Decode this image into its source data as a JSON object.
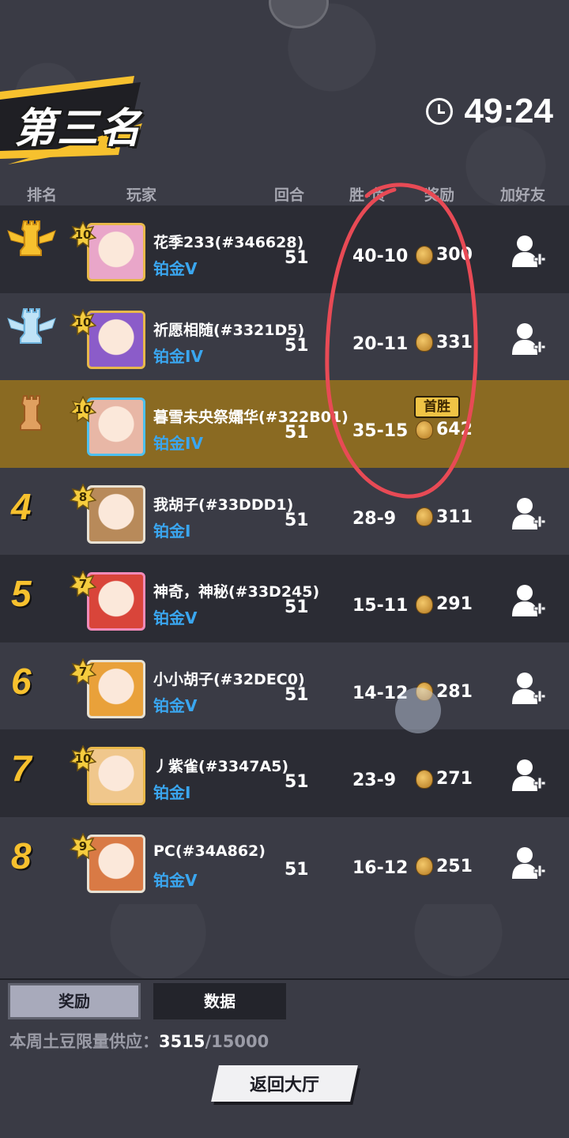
{
  "header": {
    "rank_title": "第三名",
    "timer": "49:24"
  },
  "columns": [
    "排名",
    "玩家",
    "回合",
    "胜-负",
    "奖励",
    "加好友"
  ],
  "players": [
    {
      "rank": "1",
      "level": "10",
      "name": "花季233(#346628)",
      "tier": "铂金V",
      "rounds": "51",
      "wl": "40-10",
      "reward": "300",
      "avatar_color": "#e9a6c9",
      "frame": "gold",
      "first_win": ""
    },
    {
      "rank": "2",
      "level": "10",
      "name": "祈愿相随(#3321D5)",
      "tier": "铂金IV",
      "rounds": "51",
      "wl": "20-11",
      "reward": "331",
      "avatar_color": "#8b5cc9",
      "frame": "gold",
      "first_win": ""
    },
    {
      "rank": "3",
      "level": "10",
      "name": "暮雪未央祭孀华(#322B01)",
      "tier": "铂金IV",
      "rounds": "51",
      "wl": "35-15",
      "reward": "642",
      "avatar_color": "#e8b7a6",
      "frame": "blue",
      "first_win": "首胜"
    },
    {
      "rank": "4",
      "level": "8",
      "name": "我胡子(#33DDD1)",
      "tier": "铂金I",
      "rounds": "51",
      "wl": "28-9",
      "reward": "311",
      "avatar_color": "#b88a5a",
      "frame": "plain",
      "first_win": ""
    },
    {
      "rank": "5",
      "level": "7",
      "name": "神奇，神秘(#33D245)",
      "tier": "铂金V",
      "rounds": "51",
      "wl": "15-11",
      "reward": "291",
      "avatar_color": "#d9453a",
      "frame": "pink",
      "first_win": ""
    },
    {
      "rank": "6",
      "level": "7",
      "name": "小小胡子(#32DEC0)",
      "tier": "铂金V",
      "rounds": "51",
      "wl": "14-12",
      "reward": "281",
      "avatar_color": "#e9a13a",
      "frame": "plain",
      "first_win": ""
    },
    {
      "rank": "7",
      "level": "10",
      "name": "丿紫雀(#3347A5)",
      "tier": "铂金I",
      "rounds": "51",
      "wl": "23-9",
      "reward": "271",
      "avatar_color": "#f0c78c",
      "frame": "gold",
      "first_win": ""
    },
    {
      "rank": "8",
      "level": "9",
      "name": "PC(#34A862)",
      "tier": "铂金V",
      "rounds": "51",
      "wl": "16-12",
      "reward": "251",
      "avatar_color": "#d97a45",
      "frame": "plain",
      "first_win": ""
    }
  ],
  "tabs": {
    "rewards": "奖励",
    "stats": "数据"
  },
  "supply": {
    "label": "本周土豆限量供应：",
    "current": "3515",
    "total": "/15000"
  },
  "back_button": "返回大厅",
  "colors": {
    "tier_blue": "#3aa6ef",
    "rank_gold": "#f7c12e",
    "self_row": "#8a6a22",
    "annotation_red": "#e84a55"
  },
  "icons": [
    "clock-icon",
    "gold-chess-rook-icon",
    "silver-chess-rook-icon",
    "bronze-chess-rook-icon",
    "potato-coin-icon",
    "add-friend-icon",
    "level-star-icon"
  ]
}
